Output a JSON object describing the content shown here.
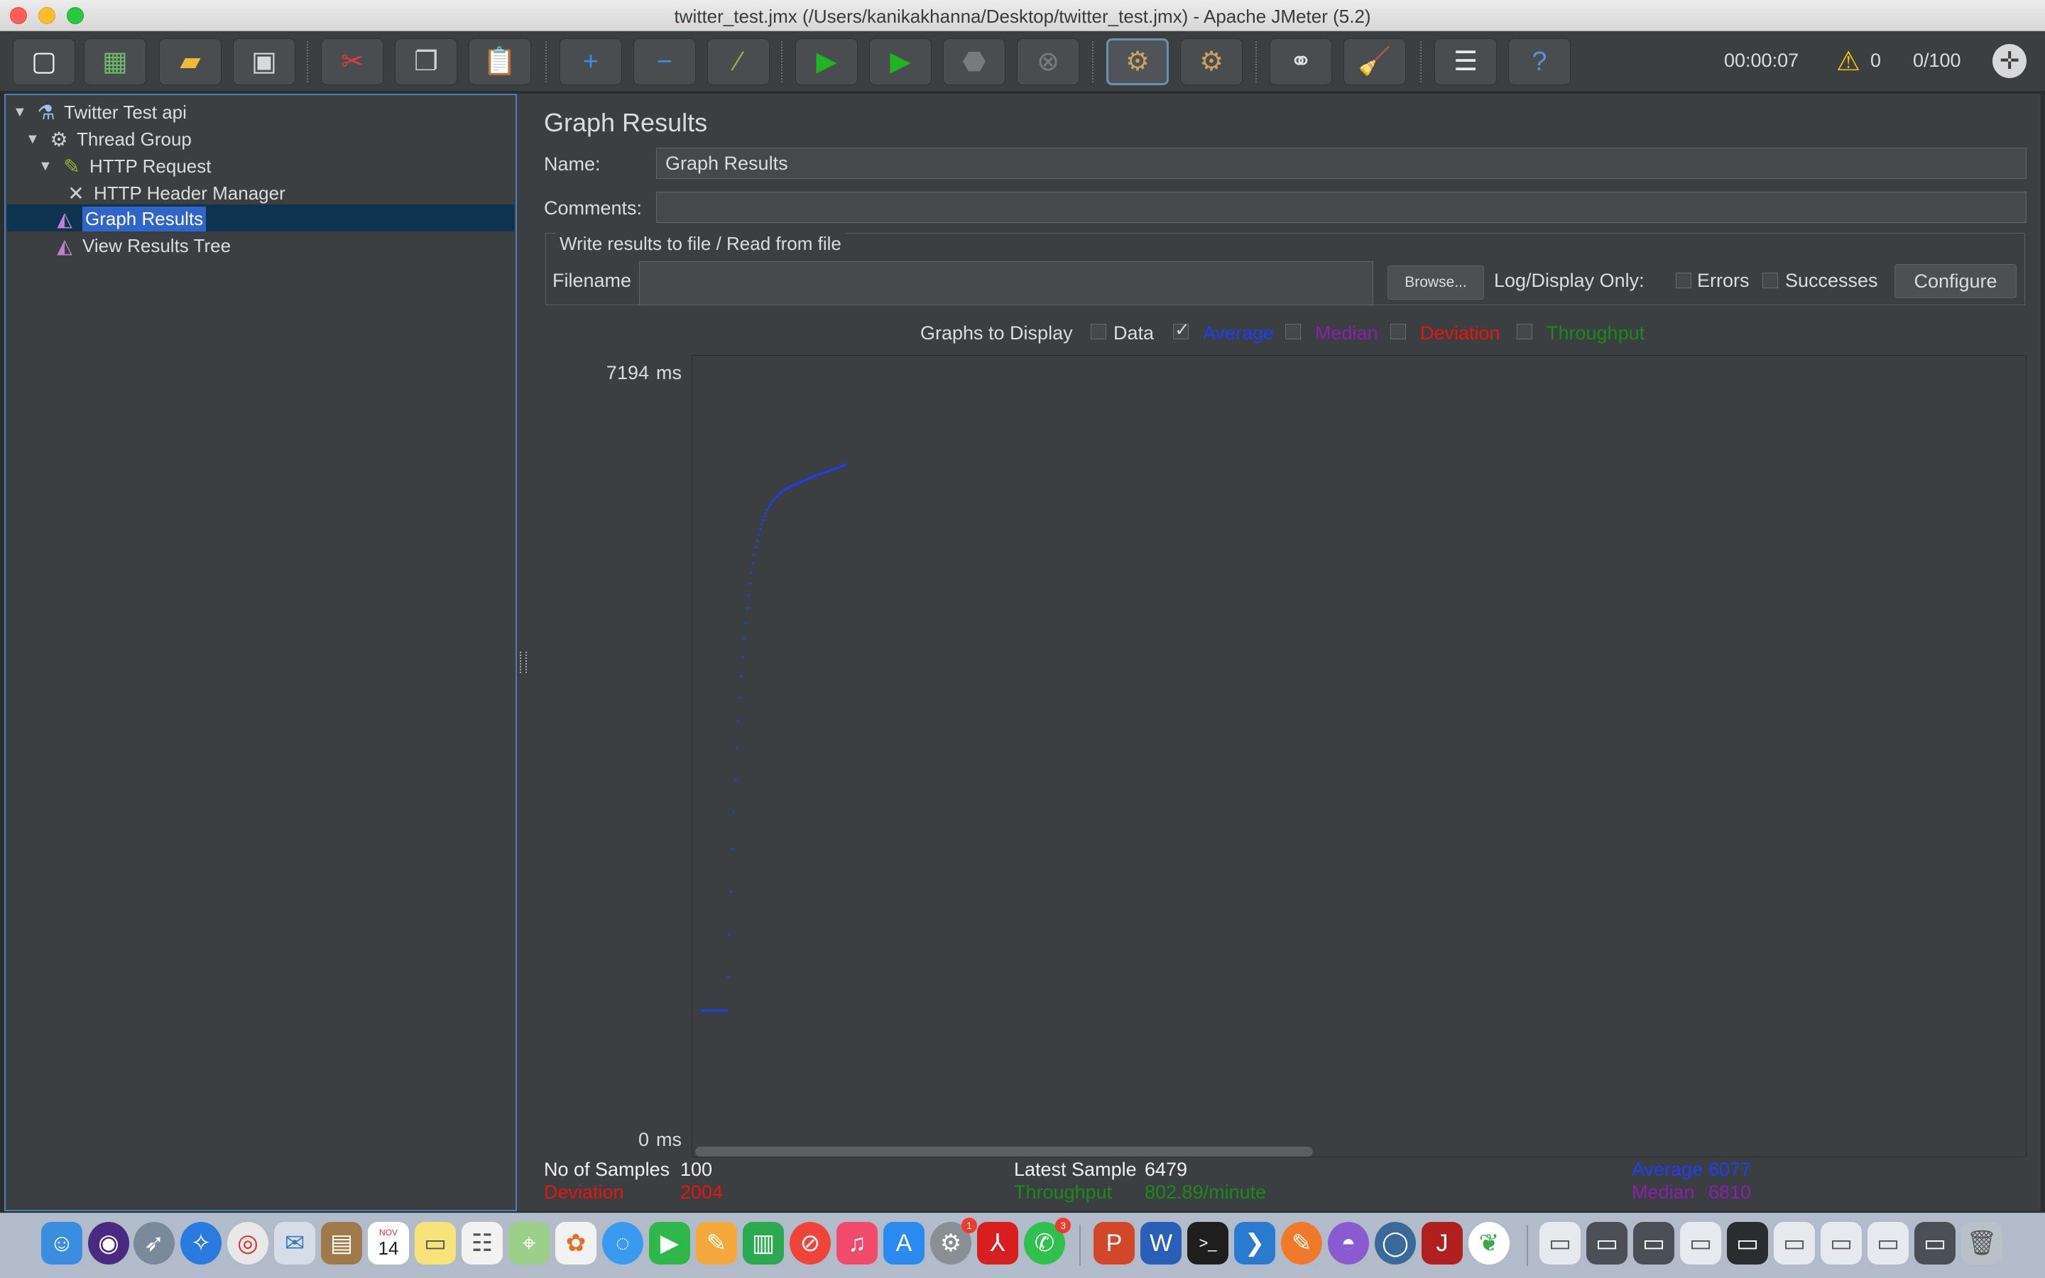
{
  "window": {
    "title": "twitter_test.jmx (/Users/kanikakhanna/Desktop/twitter_test.jmx) - Apache JMeter (5.2)"
  },
  "toolbar": {
    "elapsed_time": "00:00:07",
    "warning_count": "0",
    "active_threads": "0/100",
    "buttons": [
      "new",
      "templates",
      "open",
      "save",
      "cut",
      "copy",
      "paste",
      "expand",
      "collapse",
      "toggle",
      "start",
      "start-no-pauses",
      "stop",
      "shutdown",
      "clear",
      "clear-all",
      "search",
      "reset-search",
      "function-helper",
      "help"
    ]
  },
  "tree": {
    "items": [
      {
        "label": "Twitter Test api",
        "icon": "test-plan-icon",
        "expanded": true
      },
      {
        "label": "Thread Group",
        "icon": "gear-icon",
        "expanded": true
      },
      {
        "label": "HTTP Request",
        "icon": "pipette-icon",
        "expanded": true
      },
      {
        "label": "HTTP Header Manager",
        "icon": "wrench-icon"
      },
      {
        "label": "Graph Results",
        "icon": "graph-icon",
        "selected": true
      },
      {
        "label": "View Results Tree",
        "icon": "graph-icon"
      }
    ]
  },
  "main": {
    "title": "Graph Results",
    "name_label": "Name:",
    "name_value": "Graph Results",
    "comments_label": "Comments:",
    "comments_value": "",
    "file_section": {
      "legend": "Write results to file / Read from file",
      "filename_label": "Filename",
      "filename_value": "",
      "browse_label": "Browse...",
      "log_only_label": "Log/Display Only:",
      "errors_label": "Errors",
      "successes_label": "Successes",
      "configure_label": "Configure"
    },
    "graphs_to_display": {
      "label": "Graphs to Display",
      "options": [
        {
          "label": "Data",
          "checked": false,
          "color": "#dcdcdc"
        },
        {
          "label": "Average",
          "checked": true,
          "color": "#1f3df5"
        },
        {
          "label": "Median",
          "checked": false,
          "color": "#8a1fb0"
        },
        {
          "label": "Deviation",
          "checked": false,
          "color": "#e8150e"
        },
        {
          "label": "Throughput",
          "checked": false,
          "color": "#1a8a1a"
        }
      ]
    },
    "graph": {
      "y_max_label": "7194",
      "y_min_label": "0",
      "y_unit": "ms"
    },
    "stats": {
      "samples_label": "No of Samples",
      "samples_value": "100",
      "latest_label": "Latest Sample",
      "latest_value": "6479",
      "average_label": "Average",
      "average_value": "6077",
      "deviation_label": "Deviation",
      "deviation_value": "2004",
      "throughput_label": "Throughput",
      "throughput_value": "802.89/minute",
      "median_label": "Median",
      "median_value": "6810"
    }
  },
  "chart_data": {
    "type": "line",
    "title": "",
    "xlabel": "",
    "ylabel": "",
    "ylim": [
      0,
      7194
    ],
    "y_unit": "ms",
    "grid": false,
    "series": [
      {
        "name": "Average",
        "color": "#1f3df5",
        "x": [
          1,
          2,
          3,
          4,
          5,
          6,
          7,
          8,
          9,
          10,
          11,
          12,
          13,
          14,
          15,
          16,
          17,
          18,
          19,
          20,
          21,
          22,
          23,
          24,
          25,
          26,
          27,
          28,
          29,
          30,
          31,
          32,
          33,
          34,
          35,
          36,
          37,
          38,
          39,
          40,
          41,
          42,
          43,
          44,
          45,
          46,
          47,
          48,
          49,
          50,
          51,
          52,
          53,
          54,
          55,
          56,
          57,
          58,
          59,
          60,
          61,
          62,
          63,
          64,
          65,
          66,
          67,
          68,
          69,
          70,
          71,
          72,
          73,
          74,
          75,
          76,
          77,
          78,
          79,
          80,
          81,
          82,
          83,
          84,
          85,
          86,
          87,
          88,
          89,
          90,
          91,
          92,
          93,
          94,
          95,
          96,
          97,
          98,
          99,
          100
        ],
        "values": [
          1180,
          1183,
          1185,
          1183,
          1184,
          1185,
          1186,
          1185,
          1184,
          1183,
          1184,
          1185,
          1186,
          1185,
          1184,
          1184,
          1185,
          1186,
          1500,
          1900,
          2300,
          2700,
          3050,
          3350,
          3650,
          3900,
          4120,
          4320,
          4500,
          4670,
          4820,
          4960,
          5080,
          5190,
          5290,
          5380,
          5460,
          5530,
          5590,
          5650,
          5700,
          5745,
          5785,
          5820,
          5850,
          5880,
          5906,
          5930,
          5950,
          5970,
          5988,
          6004,
          6018,
          6030,
          6042,
          6052,
          6062,
          6070,
          6078,
          6086,
          6093,
          6100,
          6106,
          6112,
          6118,
          6124,
          6130,
          6136,
          6142,
          6148,
          6154,
          6160,
          6166,
          6172,
          6178,
          6184,
          6190,
          6196,
          6201,
          6206,
          6211,
          6216,
          6221,
          6226,
          6231,
          6236,
          6241,
          6246,
          6251,
          6256,
          6261,
          6266,
          6271,
          6276,
          6281,
          6286,
          6291,
          6296,
          6300,
          6304
        ]
      }
    ]
  },
  "dock": {
    "calendar_month": "NOV",
    "calendar_day": "14",
    "badges": [
      "1",
      "3"
    ],
    "apps": [
      "finder",
      "siri",
      "launchpad",
      "safari",
      "chrome",
      "mail",
      "notes-book",
      "calendar",
      "stickies",
      "reminders",
      "maps",
      "photos",
      "messages",
      "facetime",
      "pages",
      "numbers",
      "news",
      "music",
      "app-store",
      "system-preferences",
      "acrobat",
      "whatsapp",
      "powerpoint",
      "word",
      "terminal",
      "vscode",
      "sublime",
      "github",
      "quicktime",
      "jmeter",
      "mongodb"
    ]
  }
}
